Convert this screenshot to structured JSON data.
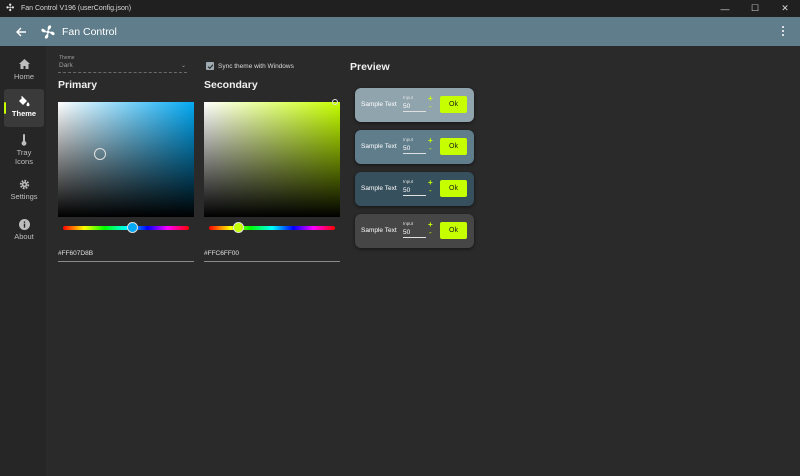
{
  "window": {
    "title": "Fan Control V196 (userConfig.json)",
    "controls": {
      "minimize": "—",
      "maximize": "☐",
      "close": "✕"
    }
  },
  "appbar": {
    "title": "Fan Control"
  },
  "sidebar": {
    "items": [
      {
        "label": "Home",
        "icon": "home-icon",
        "active": false
      },
      {
        "label": "Theme",
        "icon": "paint-bucket-icon",
        "active": true
      },
      {
        "label": "Tray Icons",
        "icon": "thermometer-icon",
        "active": false
      },
      {
        "label": "Settings",
        "icon": "gear-icon",
        "active": false
      },
      {
        "label": "About",
        "icon": "info-icon",
        "active": false
      }
    ]
  },
  "theme_select": {
    "label": "Theme",
    "value": "Dark"
  },
  "sync": {
    "label": "Sync theme with Windows",
    "checked": true
  },
  "primary": {
    "heading": "Primary",
    "hex": "#FF607D8B",
    "hue_color": "#03a9f4"
  },
  "secondary": {
    "heading": "Secondary",
    "hex": "#FFC6FF00",
    "hue_color": "#c6ff00"
  },
  "preview": {
    "heading": "Preview",
    "cards": [
      {
        "text": "Sample Text",
        "input_label": "Input",
        "input_value": "50",
        "plus": "+",
        "minus": "-",
        "button": "Ok",
        "bg": "#90a4ae"
      },
      {
        "text": "Sample Text",
        "input_label": "Input",
        "input_value": "50",
        "plus": "+",
        "minus": "-",
        "button": "Ok",
        "bg": "#607d8b"
      },
      {
        "text": "Sample Text",
        "input_label": "Input",
        "input_value": "50",
        "plus": "+",
        "minus": "-",
        "button": "Ok",
        "bg": "#37505d"
      },
      {
        "text": "Sample Text",
        "input_label": "Input",
        "input_value": "50",
        "plus": "+",
        "minus": "-",
        "button": "Ok",
        "bg": "#464646"
      }
    ]
  },
  "colors": {
    "accent": "#c6ff00",
    "appbar": "#607d8b"
  }
}
